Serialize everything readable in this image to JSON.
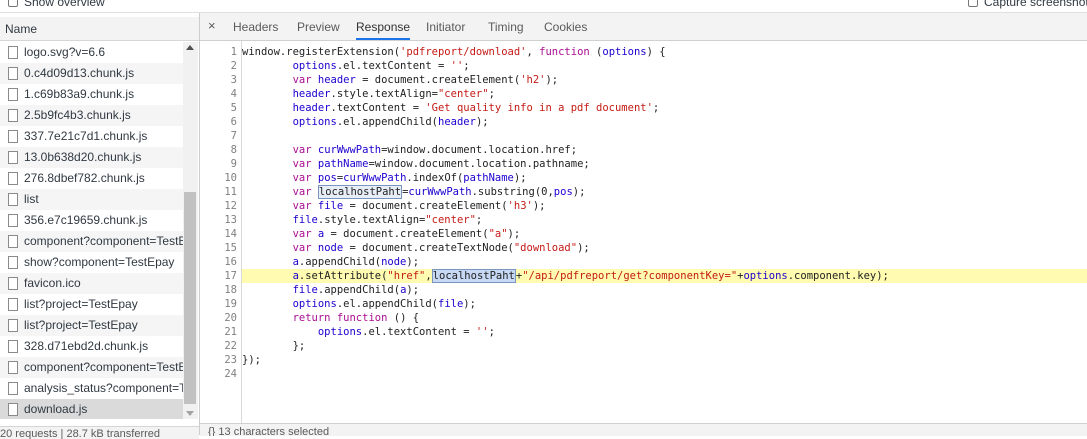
{
  "topbar": {
    "show_overview": "Show overview",
    "capture_screenshots": "Capture screenshots"
  },
  "left_panel": {
    "header": "Name",
    "files": [
      "logo.svg?v=6.6",
      "0.c4d09d13.chunk.js",
      "1.c69b83a9.chunk.js",
      "2.5b9fc4b3.chunk.js",
      "337.7e21c7d1.chunk.js",
      "13.0b638d20.chunk.js",
      "276.8dbef782.chunk.js",
      "list",
      "356.e7c19659.chunk.js",
      "component?component=TestEpay",
      "show?component=TestEpay",
      "favicon.ico",
      "list?project=TestEpay",
      "list?project=TestEpay",
      "328.d71ebd2d.chunk.js",
      "component?component=TestEpay",
      "analysis_status?component=TestEpay",
      "download.js"
    ],
    "selected_index": 17,
    "status": "20 requests  |  28.7 kB transferred"
  },
  "tabs": [
    "Headers",
    "Preview",
    "Response",
    "Initiator",
    "Timing",
    "Cookies"
  ],
  "active_tab": "Response",
  "close_icon": "×",
  "code_lines": [
    "window.registerExtension('pdfreport/download', function (options) {",
    "        options.el.textContent = '';",
    "        var header = document.createElement('h2');",
    "        header.style.textAlign=\"center\";",
    "        header.textContent = 'Get quality info in a pdf document';",
    "        options.el.appendChild(header);",
    "",
    "        var curWwwPath=window.document.location.href;",
    "        var pathName=window.document.location.pathname;",
    "        var pos=curWwwPath.indexOf(pathName);",
    "        var localhostPaht=curWwwPath.substring(0,pos);",
    "        var file = document.createElement('h3');",
    "        file.style.textAlign=\"center\";",
    "        var a = document.createElement(\"a\");",
    "        var node = document.createTextNode(\"download\");",
    "        a.appendChild(node);",
    "        a.setAttribute(\"href\",localhostPaht+\"/api/pdfreport/get?componentKey=\"+options.component.key);",
    "        file.appendChild(a);",
    "        options.el.appendChild(file);",
    "        return function () {",
    "            options.el.textContent = '';",
    "        };",
    "});",
    ""
  ],
  "highlighted_line": 17,
  "bottom_status": "{}  13 characters selected",
  "colors": {
    "keyword": "#aa0d91",
    "string": "#c41a16",
    "variable": "#1c00cf",
    "line_highlight": "#fffbb0",
    "active_tab_underline": "#1a73e8"
  }
}
